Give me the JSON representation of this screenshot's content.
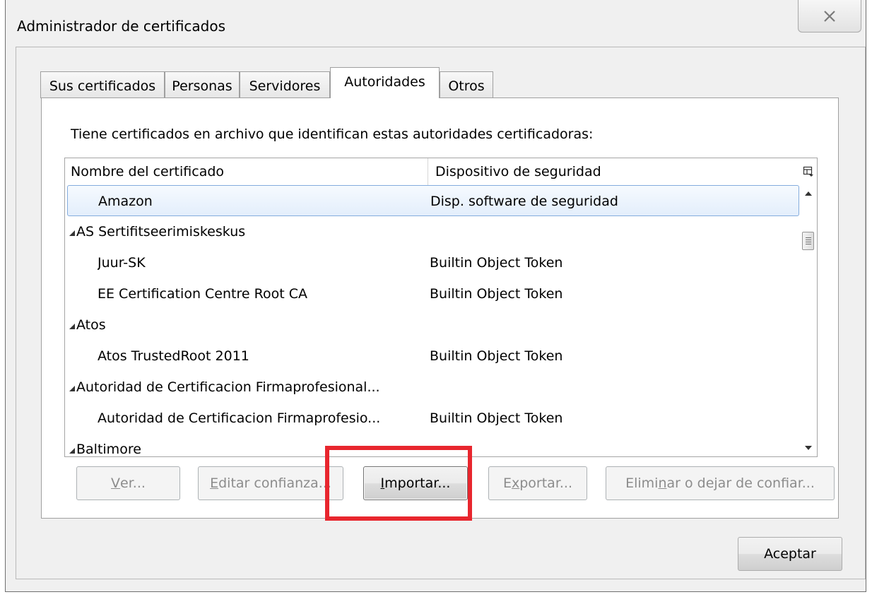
{
  "window": {
    "title": "Administrador de certificados",
    "close_icon": "close-icon"
  },
  "tabs": [
    {
      "label": "Sus certificados",
      "selected": false
    },
    {
      "label": "Personas",
      "selected": false
    },
    {
      "label": "Servidores",
      "selected": false
    },
    {
      "label": "Autoridades",
      "selected": true
    },
    {
      "label": "Otros",
      "selected": false
    }
  ],
  "panel": {
    "description": "Tiene certificados en archivo que identifican estas autoridades certificadoras:"
  },
  "tree": {
    "columns": [
      "Nombre del certificado",
      "Dispositivo de seguridad"
    ],
    "rows": [
      {
        "name": "Amazon",
        "device": "Disp. software de seguridad",
        "group": false,
        "selected": true
      },
      {
        "name": "AS Sertifitseerimiskeskus",
        "device": "",
        "group": true
      },
      {
        "name": "Juur-SK",
        "device": "Builtin Object Token",
        "group": false
      },
      {
        "name": "EE Certification Centre Root CA",
        "device": "Builtin Object Token",
        "group": false
      },
      {
        "name": "Atos",
        "device": "",
        "group": true
      },
      {
        "name": "Atos TrustedRoot 2011",
        "device": "Builtin Object Token",
        "group": false
      },
      {
        "name": "Autoridad de Certificacion Firmaprofesional...",
        "device": "",
        "group": true
      },
      {
        "name": "Autoridad de Certificacion Firmaprofesio...",
        "device": "Builtin Object Token",
        "group": false
      },
      {
        "name": "Baltimore",
        "device": "",
        "group": true
      }
    ]
  },
  "buttons": {
    "ver": {
      "pre": "",
      "acc": "V",
      "post": "er..."
    },
    "editar": {
      "pre": "",
      "acc": "E",
      "post": "ditar confianza..."
    },
    "importar": {
      "pre": "",
      "acc": "I",
      "post": "mportar..."
    },
    "exportar": {
      "pre": "E",
      "acc": "x",
      "post": "portar..."
    },
    "eliminar": {
      "pre": "Elimi",
      "acc": "n",
      "post": "ar o dejar de confiar..."
    },
    "aceptar": "Aceptar"
  },
  "colors": {
    "highlight": "#e8262e",
    "selection_border": "#84acdd"
  }
}
